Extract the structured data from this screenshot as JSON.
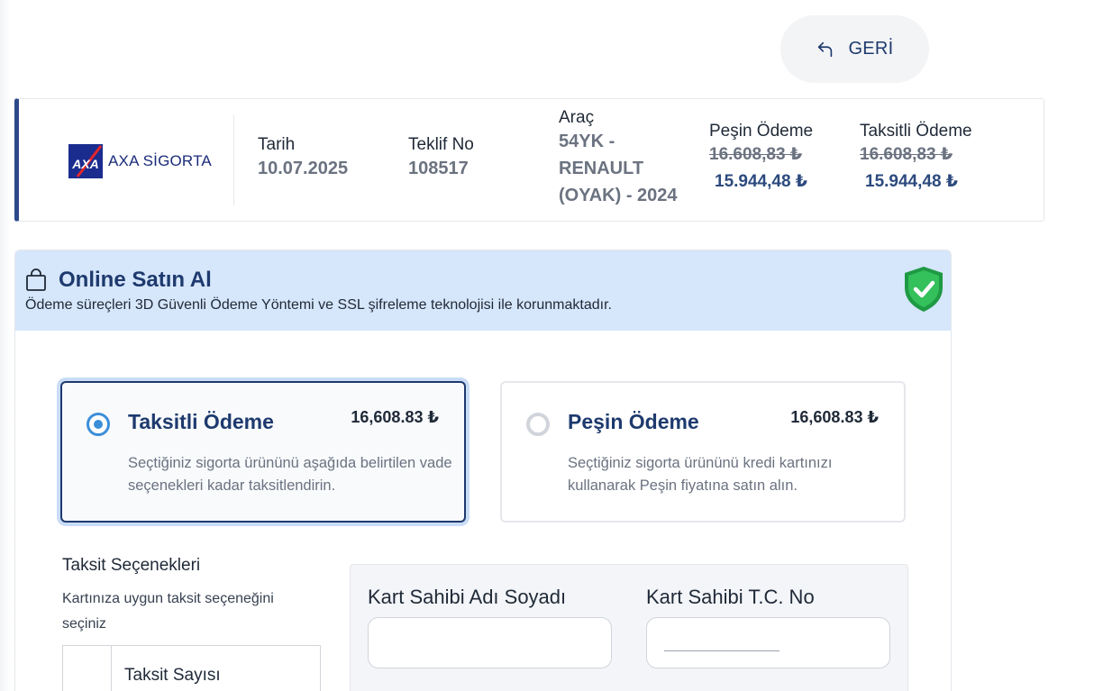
{
  "back_button": {
    "label": "GERİ",
    "icon": "return-arrow-icon"
  },
  "quote": {
    "company": {
      "name": "AXA SİGORTA",
      "logo_text": "AXA"
    },
    "date": {
      "label": "Tarih",
      "value": "10.07.2025"
    },
    "offer_no": {
      "label": "Teklif No",
      "value": "108517"
    },
    "vehicle": {
      "label": "Araç",
      "lines": [
        "54YK -",
        "RENAULT",
        "(OYAK) - 2024"
      ]
    },
    "cash_payment": {
      "label": "Peşin Ödeme",
      "old_price": "16.608,83 ₺",
      "new_price": "15.944,48 ₺"
    },
    "installment_payment": {
      "label": "Taksitli Ödeme",
      "old_price": "16.608,83 ₺",
      "new_price": "15.944,48 ₺"
    }
  },
  "online_purchase": {
    "title": "Online Satın Al",
    "subtitle": "Ödeme süreçleri 3D Güvenli Ödeme Yöntemi ve SSL şifreleme teknolojisi ile korunmaktadır.",
    "icons": {
      "bag": "shopping-bag-icon",
      "shield": "shield-check-icon"
    },
    "colors": {
      "header_bg": "#d6e6fb",
      "accent": "#1e3a6e",
      "radio": "#3b8fd9",
      "shield": "#22b04b"
    },
    "options": [
      {
        "title": "Taksitli Ödeme",
        "price": "16,608.83 ₺",
        "description": "Seçtiğiniz sigorta ürününü aşağıda belirtilen vade seçenekleri kadar taksitlendirin.",
        "selected": true
      },
      {
        "title": "Peşin Ödeme",
        "price": "16,608.83 ₺",
        "description": "Seçtiğiniz sigorta ürününü kredi kartınızı kullanarak Peşin fiyatına satın alın.",
        "selected": false
      }
    ],
    "installments": {
      "title": "Taksit Seçenekleri",
      "hint": "Kartınıza uygun taksit seçeneğini seçiniz",
      "column_header": "Taksit Sayısı"
    },
    "card_form": {
      "holder_name_label": "Kart Sahibi Adı Soyadı",
      "holder_name_value": "",
      "holder_tc_label": "Kart Sahibi T.C. No",
      "holder_tc_value": ""
    }
  }
}
